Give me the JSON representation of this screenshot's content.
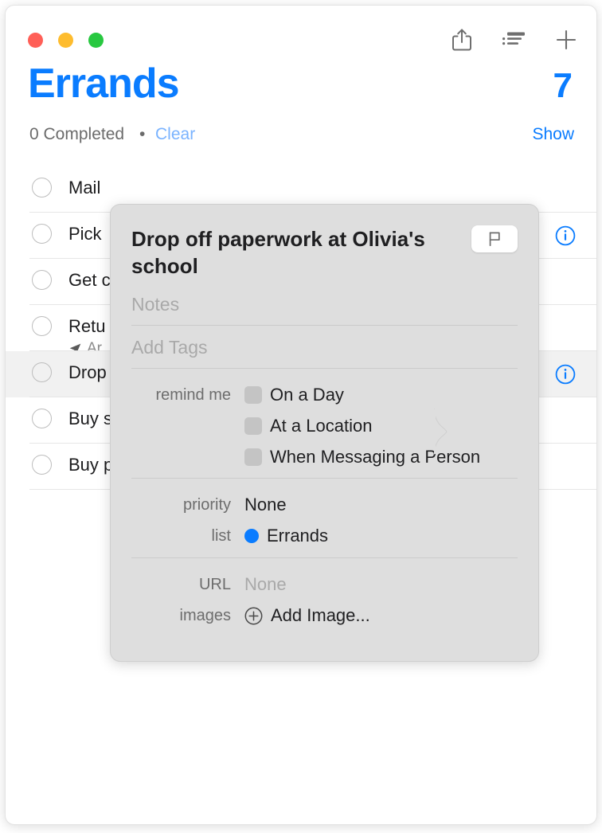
{
  "window": {
    "traffic_lights": [
      {
        "name": "close",
        "color": "#ff5f57"
      },
      {
        "name": "minimize",
        "color": "#febc2e"
      },
      {
        "name": "maximize",
        "color": "#28c840"
      }
    ],
    "toolbar_icons": [
      {
        "name": "share-icon",
        "label": "Share"
      },
      {
        "name": "list-view-icon",
        "label": "View Options"
      },
      {
        "name": "add-icon",
        "label": "Add Reminder"
      }
    ]
  },
  "header": {
    "title": "Errands",
    "count": "7",
    "completed_text": "0 Completed",
    "separator_dot": "•",
    "clear_label": "Clear",
    "show_label": "Show",
    "accent_color": "#0a7cff"
  },
  "reminders": [
    {
      "title": "Mail",
      "subtitle": "",
      "selected": false,
      "has_info": false
    },
    {
      "title": "Pick",
      "subtitle": "",
      "selected": false,
      "has_info": true
    },
    {
      "title": "Get c",
      "subtitle": "",
      "selected": false,
      "has_info": false
    },
    {
      "title": "Retu",
      "subtitle": "Ar",
      "selected": false,
      "has_info": false,
      "sub_icon": "location-arrow-icon"
    },
    {
      "title": "Drop",
      "subtitle": "",
      "selected": true,
      "has_info": true
    },
    {
      "title": "Buy s",
      "subtitle": "",
      "selected": false,
      "has_info": false
    },
    {
      "title": "Buy p",
      "subtitle": "",
      "selected": false,
      "has_info": false
    }
  ],
  "popover": {
    "title": "Drop off paperwork at Olivia's school",
    "flag_icon": "flag-icon",
    "notes_placeholder": "Notes",
    "tags_placeholder": "Add Tags",
    "remind_me_label": "remind me",
    "remind_options": [
      {
        "label": "On a Day",
        "checked": false
      },
      {
        "label": "At a Location",
        "checked": false
      },
      {
        "label": "When Messaging a Person",
        "checked": false
      }
    ],
    "priority_label": "priority",
    "priority_value": "None",
    "list_label": "list",
    "list_value": "Errands",
    "list_color": "#0a7cff",
    "url_label": "URL",
    "url_value": "None",
    "images_label": "images",
    "add_image_label": "Add Image...",
    "add_image_icon": "plus-circle-icon"
  }
}
